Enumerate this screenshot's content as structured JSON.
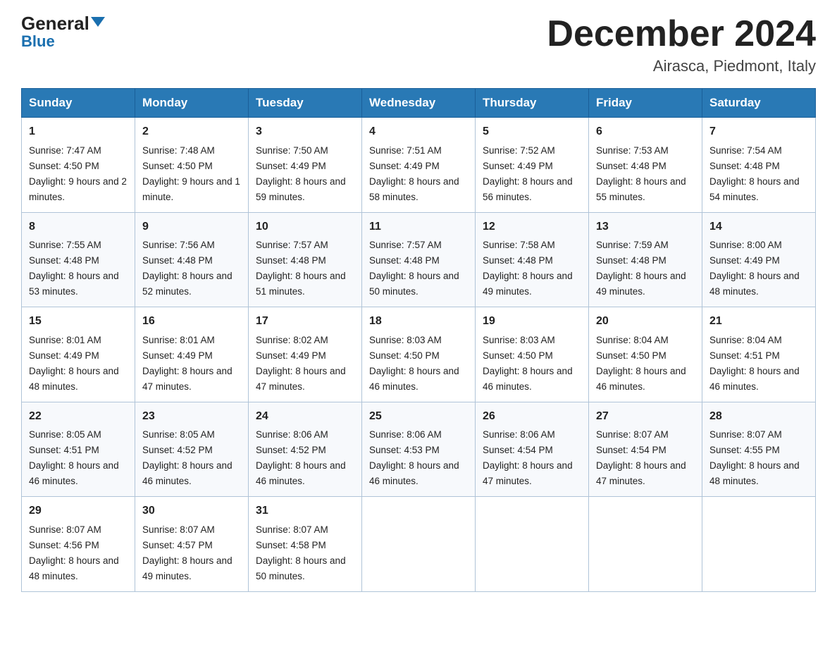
{
  "logo": {
    "general": "General",
    "blue": "Blue"
  },
  "header": {
    "title": "December 2024",
    "subtitle": "Airasca, Piedmont, Italy"
  },
  "days_of_week": [
    "Sunday",
    "Monday",
    "Tuesday",
    "Wednesday",
    "Thursday",
    "Friday",
    "Saturday"
  ],
  "weeks": [
    [
      {
        "day": "1",
        "sunrise": "7:47 AM",
        "sunset": "4:50 PM",
        "daylight": "9 hours and 2 minutes."
      },
      {
        "day": "2",
        "sunrise": "7:48 AM",
        "sunset": "4:50 PM",
        "daylight": "9 hours and 1 minute."
      },
      {
        "day": "3",
        "sunrise": "7:50 AM",
        "sunset": "4:49 PM",
        "daylight": "8 hours and 59 minutes."
      },
      {
        "day": "4",
        "sunrise": "7:51 AM",
        "sunset": "4:49 PM",
        "daylight": "8 hours and 58 minutes."
      },
      {
        "day": "5",
        "sunrise": "7:52 AM",
        "sunset": "4:49 PM",
        "daylight": "8 hours and 56 minutes."
      },
      {
        "day": "6",
        "sunrise": "7:53 AM",
        "sunset": "4:48 PM",
        "daylight": "8 hours and 55 minutes."
      },
      {
        "day": "7",
        "sunrise": "7:54 AM",
        "sunset": "4:48 PM",
        "daylight": "8 hours and 54 minutes."
      }
    ],
    [
      {
        "day": "8",
        "sunrise": "7:55 AM",
        "sunset": "4:48 PM",
        "daylight": "8 hours and 53 minutes."
      },
      {
        "day": "9",
        "sunrise": "7:56 AM",
        "sunset": "4:48 PM",
        "daylight": "8 hours and 52 minutes."
      },
      {
        "day": "10",
        "sunrise": "7:57 AM",
        "sunset": "4:48 PM",
        "daylight": "8 hours and 51 minutes."
      },
      {
        "day": "11",
        "sunrise": "7:57 AM",
        "sunset": "4:48 PM",
        "daylight": "8 hours and 50 minutes."
      },
      {
        "day": "12",
        "sunrise": "7:58 AM",
        "sunset": "4:48 PM",
        "daylight": "8 hours and 49 minutes."
      },
      {
        "day": "13",
        "sunrise": "7:59 AM",
        "sunset": "4:48 PM",
        "daylight": "8 hours and 49 minutes."
      },
      {
        "day": "14",
        "sunrise": "8:00 AM",
        "sunset": "4:49 PM",
        "daylight": "8 hours and 48 minutes."
      }
    ],
    [
      {
        "day": "15",
        "sunrise": "8:01 AM",
        "sunset": "4:49 PM",
        "daylight": "8 hours and 48 minutes."
      },
      {
        "day": "16",
        "sunrise": "8:01 AM",
        "sunset": "4:49 PM",
        "daylight": "8 hours and 47 minutes."
      },
      {
        "day": "17",
        "sunrise": "8:02 AM",
        "sunset": "4:49 PM",
        "daylight": "8 hours and 47 minutes."
      },
      {
        "day": "18",
        "sunrise": "8:03 AM",
        "sunset": "4:50 PM",
        "daylight": "8 hours and 46 minutes."
      },
      {
        "day": "19",
        "sunrise": "8:03 AM",
        "sunset": "4:50 PM",
        "daylight": "8 hours and 46 minutes."
      },
      {
        "day": "20",
        "sunrise": "8:04 AM",
        "sunset": "4:50 PM",
        "daylight": "8 hours and 46 minutes."
      },
      {
        "day": "21",
        "sunrise": "8:04 AM",
        "sunset": "4:51 PM",
        "daylight": "8 hours and 46 minutes."
      }
    ],
    [
      {
        "day": "22",
        "sunrise": "8:05 AM",
        "sunset": "4:51 PM",
        "daylight": "8 hours and 46 minutes."
      },
      {
        "day": "23",
        "sunrise": "8:05 AM",
        "sunset": "4:52 PM",
        "daylight": "8 hours and 46 minutes."
      },
      {
        "day": "24",
        "sunrise": "8:06 AM",
        "sunset": "4:52 PM",
        "daylight": "8 hours and 46 minutes."
      },
      {
        "day": "25",
        "sunrise": "8:06 AM",
        "sunset": "4:53 PM",
        "daylight": "8 hours and 46 minutes."
      },
      {
        "day": "26",
        "sunrise": "8:06 AM",
        "sunset": "4:54 PM",
        "daylight": "8 hours and 47 minutes."
      },
      {
        "day": "27",
        "sunrise": "8:07 AM",
        "sunset": "4:54 PM",
        "daylight": "8 hours and 47 minutes."
      },
      {
        "day": "28",
        "sunrise": "8:07 AM",
        "sunset": "4:55 PM",
        "daylight": "8 hours and 48 minutes."
      }
    ],
    [
      {
        "day": "29",
        "sunrise": "8:07 AM",
        "sunset": "4:56 PM",
        "daylight": "8 hours and 48 minutes."
      },
      {
        "day": "30",
        "sunrise": "8:07 AM",
        "sunset": "4:57 PM",
        "daylight": "8 hours and 49 minutes."
      },
      {
        "day": "31",
        "sunrise": "8:07 AM",
        "sunset": "4:58 PM",
        "daylight": "8 hours and 50 minutes."
      },
      null,
      null,
      null,
      null
    ]
  ]
}
